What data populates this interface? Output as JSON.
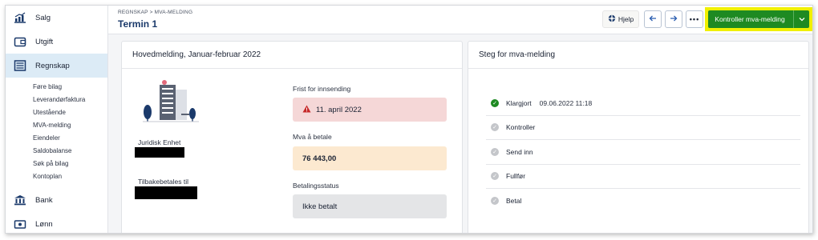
{
  "sidebar": {
    "main_items": [
      {
        "label": "Salg",
        "icon": "chart-icon"
      },
      {
        "label": "Utgift",
        "icon": "wallet-icon"
      },
      {
        "label": "Regnskap",
        "icon": "calculator-icon"
      }
    ],
    "sub_items": [
      "Føre bilag",
      "Leverandørfaktura",
      "Utestående",
      "MVA-melding",
      "Eiendeler",
      "Saldobalanse",
      "Søk på bilag",
      "Kontoplan"
    ],
    "bottom_items": [
      {
        "label": "Bank",
        "icon": "bank-icon"
      },
      {
        "label": "Lønn",
        "icon": "salary-icon"
      }
    ]
  },
  "header": {
    "breadcrumb": "REGNSKAP > MVA-MELDING",
    "title": "Termin 1",
    "help_label": "Hjelp",
    "more_label": "•••",
    "primary_label": "Kontroller mva-melding"
  },
  "main_card": {
    "title": "Hovedmelding, Januar-februar 2022",
    "deadline_label": "Frist for innsending",
    "deadline_value": "11. april 2022",
    "legal_entity_label": "Juridisk Enhet",
    "vat_label": "Mva å betale",
    "vat_value": "76 443,00",
    "refund_label": "Tilbakebetales til",
    "payment_status_label": "Betalingsstatus",
    "payment_status_value": "Ikke betalt"
  },
  "steps_card": {
    "title": "Steg for mva-melding",
    "steps": [
      {
        "label": "Klargjort",
        "timestamp": "09.06.2022 11:18",
        "status": "done"
      },
      {
        "label": "Kontroller",
        "timestamp": "",
        "status": "todo"
      },
      {
        "label": "Send inn",
        "timestamp": "",
        "status": "todo"
      },
      {
        "label": "Fullfør",
        "timestamp": "",
        "status": "todo"
      },
      {
        "label": "Betal",
        "timestamp": "",
        "status": "todo"
      }
    ]
  },
  "colors": {
    "accent": "#1e8a22",
    "highlight": "#f0f000",
    "title": "#1b3a6b",
    "warning": "#c62828"
  }
}
